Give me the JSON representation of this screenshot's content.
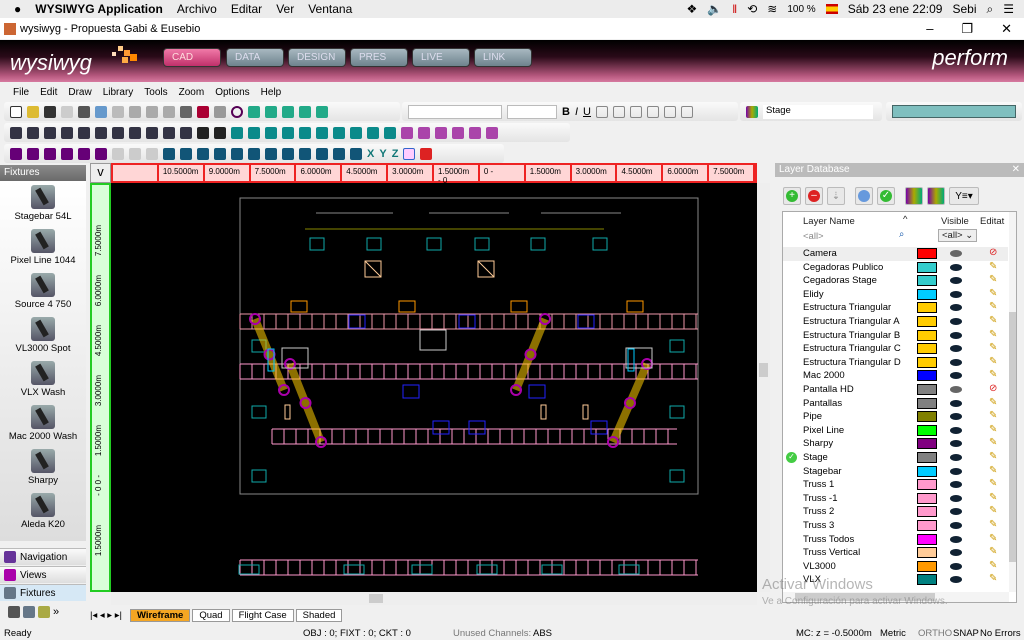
{
  "mac_menubar": {
    "app": "WYSIWYG Application",
    "menus": [
      "Archivo",
      "Editar",
      "Ver",
      "Ventana"
    ],
    "battery": "100 %",
    "datetime": "Sáb 23 ene  22:09",
    "user": "Sebi"
  },
  "window": {
    "title": "wysiwyg - Propuesta Gabi & Eusebio"
  },
  "banner": {
    "logo": "wysiwyg",
    "product": "perform",
    "tabs": [
      "CAD",
      "DATA",
      "DESIGN",
      "PRES",
      "LIVE",
      "LINK"
    ],
    "active_tab": "CAD"
  },
  "menu": [
    "File",
    "Edit",
    "Draw",
    "Library",
    "Tools",
    "Zoom",
    "Options",
    "Help"
  ],
  "toolbar": {
    "layer_select": "Stage",
    "layer_color": "#7fbfbf",
    "align_labels": [
      "X",
      "Y",
      "Z"
    ]
  },
  "left_panel": {
    "title": "Fixtures",
    "fixtures": [
      "Stagebar 54L",
      "Pixel Line 1044",
      "Source 4 750",
      "VL3000 Spot",
      "VLX Wash",
      "Mac 2000 Wash",
      "Sharpy",
      "Aleda K20"
    ],
    "nav": [
      "Navigation",
      "Views",
      "Fixtures"
    ]
  },
  "rulers": {
    "horizontal": [
      "",
      "10.5000m",
      "9.0000m",
      "7.5000m",
      "6.0000m",
      "4.5000m",
      "3.0000m",
      "1.5000m  - 0",
      "0 -",
      "1.5000m",
      "3.0000m",
      "4.5000m",
      "6.0000m",
      "7.5000m"
    ],
    "vertical": [
      "7.5000m",
      "6.0000m",
      "4.5000m",
      "3.0000m",
      "1.5000m",
      "- 0 0 -",
      "1.5000m"
    ]
  },
  "view_tabs": {
    "tabs": [
      "Wireframe",
      "Quad",
      "Flight Case",
      "Shaded"
    ],
    "active": "Wireframe"
  },
  "status": {
    "ready": "Ready",
    "counts": "OBJ : 0; FIXT : 0; CKT : 0",
    "unused": "Unused Channels:",
    "abs": "ABS",
    "mc": "MC: z = -0.5000m",
    "units": "Metric",
    "ortho": "ORTHO",
    "snap": "SNAP",
    "errors": "No Errors"
  },
  "layer_db": {
    "title": "Layer Database",
    "col_name": "Layer Name",
    "col_visible": "Visible",
    "col_editable": "Editat",
    "filter_name": "<all>",
    "filter_visible": "<all>",
    "layers": [
      {
        "name": "Camera",
        "color": "#ff0000",
        "visible": false,
        "editable": false
      },
      {
        "name": "Cegadoras Publico",
        "color": "#33cccc",
        "visible": true,
        "editable": true
      },
      {
        "name": "Cegadoras Stage",
        "color": "#33cccc",
        "visible": true,
        "editable": true
      },
      {
        "name": "Elidy",
        "color": "#00ccff",
        "visible": true,
        "editable": true
      },
      {
        "name": "Estructura Triangular",
        "color": "#ffcc00",
        "visible": true,
        "editable": true
      },
      {
        "name": "Estructura Triangular A",
        "color": "#ffcc00",
        "visible": true,
        "editable": true
      },
      {
        "name": "Estructura Triangular B",
        "color": "#ffcc00",
        "visible": true,
        "editable": true
      },
      {
        "name": "Estructura Triangular C",
        "color": "#ffcc00",
        "visible": true,
        "editable": true
      },
      {
        "name": "Estructura Triangular D",
        "color": "#ffcc00",
        "visible": true,
        "editable": true
      },
      {
        "name": "Mac 2000",
        "color": "#0000ff",
        "visible": true,
        "editable": true
      },
      {
        "name": "Pantalla HD",
        "color": "#808080",
        "visible": false,
        "editable": false
      },
      {
        "name": "Pantallas",
        "color": "#808080",
        "visible": true,
        "editable": true
      },
      {
        "name": "Pipe",
        "color": "#808000",
        "visible": true,
        "editable": true
      },
      {
        "name": "Pixel Line",
        "color": "#00ff00",
        "visible": true,
        "editable": true
      },
      {
        "name": "Sharpy",
        "color": "#800080",
        "visible": true,
        "editable": true
      },
      {
        "name": "Stage",
        "color": "#808080",
        "visible": true,
        "editable": true,
        "current": true
      },
      {
        "name": "Stagebar",
        "color": "#00ccff",
        "visible": true,
        "editable": true
      },
      {
        "name": "Truss 1",
        "color": "#ff99cc",
        "visible": true,
        "editable": true
      },
      {
        "name": "Truss -1",
        "color": "#ff99cc",
        "visible": true,
        "editable": true
      },
      {
        "name": "Truss 2",
        "color": "#ff99cc",
        "visible": true,
        "editable": true
      },
      {
        "name": "Truss 3",
        "color": "#ff99cc",
        "visible": true,
        "editable": true
      },
      {
        "name": "Truss Todos",
        "color": "#ff00ff",
        "visible": true,
        "editable": true
      },
      {
        "name": "Truss Vertical",
        "color": "#ffcc99",
        "visible": true,
        "editable": true
      },
      {
        "name": "VL3000",
        "color": "#ff9900",
        "visible": true,
        "editable": true
      },
      {
        "name": "VLX",
        "color": "#008080",
        "visible": true,
        "editable": true
      }
    ]
  },
  "watermark": {
    "line1": "Activar Windows",
    "line2": "Ve a Configuración para activar Windows."
  }
}
